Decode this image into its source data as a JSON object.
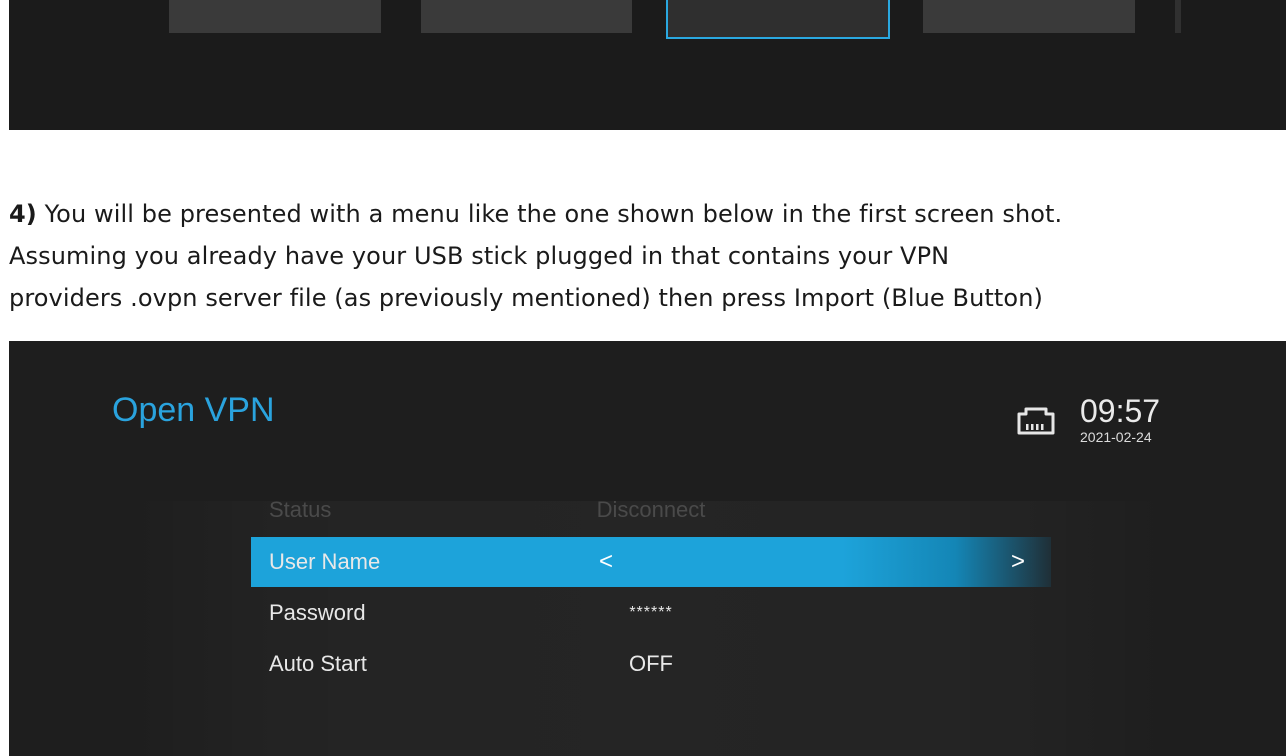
{
  "instructions": {
    "step_number": "4)",
    "line1_rest": " You will be presented with a menu like the one shown below in the first screen shot.",
    "line2": "Assuming you already have your USB stick plugged in that contains your VPN",
    "line3": "providers .ovpn server file (as previously mentioned) then press Import (Blue Button)"
  },
  "vpn": {
    "title": "Open VPN",
    "clock": {
      "time": "09:57",
      "date": "2021-02-24"
    },
    "network_icon": "network-port-icon",
    "rows": [
      {
        "label": "Status",
        "value": "Disconnect",
        "state": "disabled"
      },
      {
        "label": "User Name",
        "value": "",
        "state": "selected",
        "left_arrow": "<",
        "right_arrow": ">"
      },
      {
        "label": "Password",
        "value": "******",
        "state": "normal"
      },
      {
        "label": "Auto Start",
        "value": "OFF",
        "state": "normal"
      }
    ]
  },
  "colors": {
    "accent": "#2aa3de",
    "selection": "#1da3da",
    "background": "#1e1e1e"
  }
}
